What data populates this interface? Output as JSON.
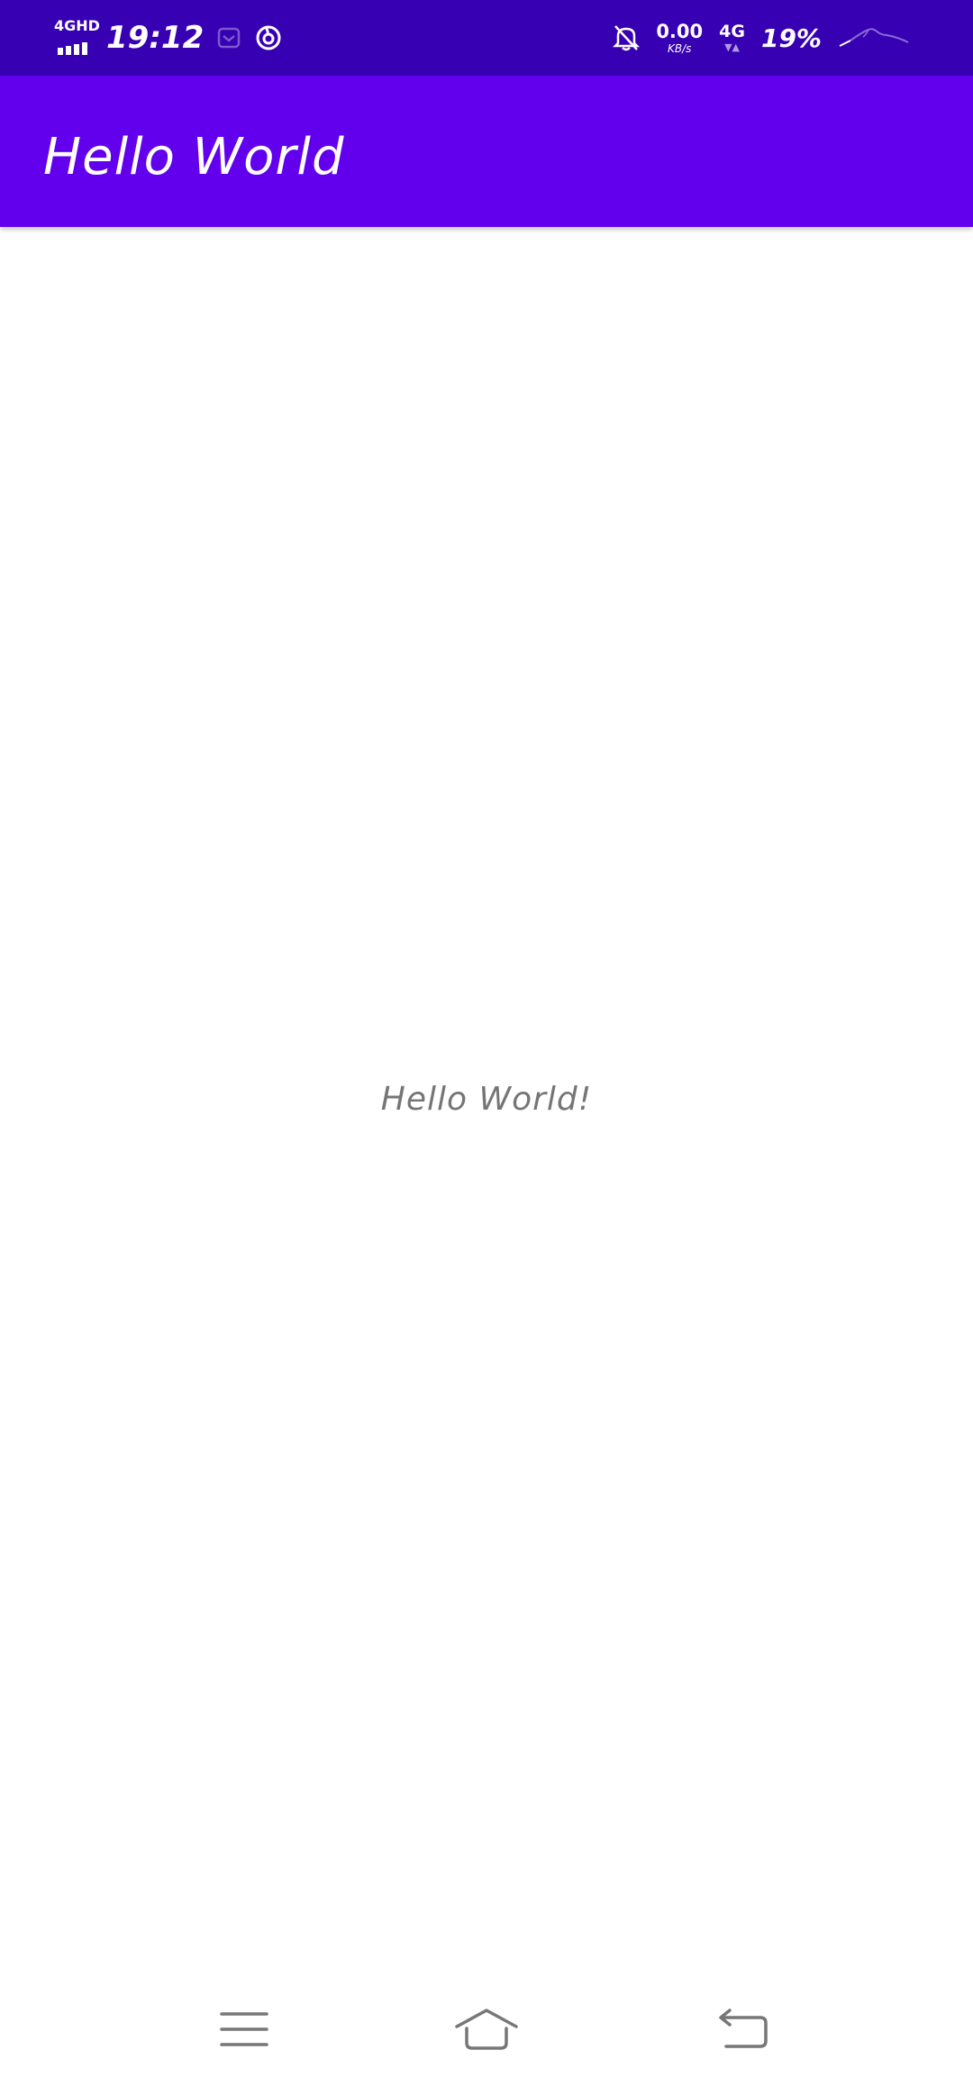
{
  "status_bar": {
    "network_label": "4GHD",
    "time": "19:12",
    "net_speed_value": "0.00",
    "net_speed_unit": "KB/s",
    "mobile_data_label": "4G",
    "mobile_data_arrows": "▼▲",
    "battery_percent": "19%",
    "background_color": "#3700B3"
  },
  "app_bar": {
    "title": "Hello World",
    "background_color": "#6200EE"
  },
  "content": {
    "message": "Hello World!"
  },
  "nav_bar": {
    "buttons": [
      "menu-icon",
      "home-icon",
      "back-icon"
    ]
  }
}
